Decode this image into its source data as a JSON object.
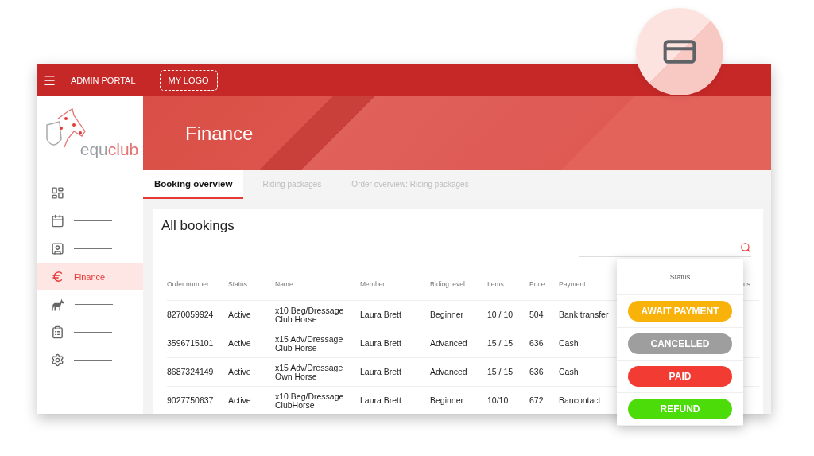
{
  "header": {
    "title": "ADMIN PORTAL",
    "logo_placeholder": "MY LOGO"
  },
  "brand": {
    "prefix": "equ",
    "suffix": "club"
  },
  "sidebar": {
    "items": [
      {
        "selected": false
      },
      {
        "selected": false
      },
      {
        "selected": false
      },
      {
        "label": "Finance",
        "selected": true
      },
      {
        "selected": false
      },
      {
        "selected": false
      },
      {
        "selected": false
      }
    ]
  },
  "banner": {
    "title": "Finance"
  },
  "tabs": [
    {
      "label": "Booking overview",
      "selected": true
    },
    {
      "label": "Riding packages",
      "selected": false
    },
    {
      "label": "Order overview: Riding packages",
      "selected": false
    }
  ],
  "card": {
    "title": "All bookings"
  },
  "table": {
    "columns": [
      "Order number",
      "Status",
      "Name",
      "Member",
      "Riding level",
      "Items",
      "Price",
      "Payment",
      "ns"
    ],
    "rows": [
      [
        "8270059924",
        "Active",
        "x10 Beg/Dressage Club Horse",
        "Laura Brett",
        "Beginner",
        "10 / 10",
        "504",
        "Bank transfer"
      ],
      [
        "3596715101",
        "Active",
        "x15 Adv/Dressage Club Horse",
        "Laura Brett",
        "Advanced",
        "15 / 15",
        "636",
        "Cash"
      ],
      [
        "8687324149",
        "Active",
        "x15 Adv/Dressage Own Horse",
        "Laura Brett",
        "Advanced",
        "15 / 15",
        "636",
        "Cash"
      ],
      [
        "9027750637",
        "Active",
        "x10 Beg/Dressage ClubHorse",
        "Laura Brett",
        "Beginner",
        "10/10",
        "672",
        "Bancontact"
      ]
    ]
  },
  "status_popup": {
    "title": "Status",
    "options": [
      {
        "label": "AWAIT PAYMENT",
        "color": "#f8b20a"
      },
      {
        "label": "CANCELLED",
        "color": "#9e9e9e"
      },
      {
        "label": "PAID",
        "color": "#f23b32"
      },
      {
        "label": "REFUND",
        "color": "#4cdc0a"
      }
    ]
  }
}
